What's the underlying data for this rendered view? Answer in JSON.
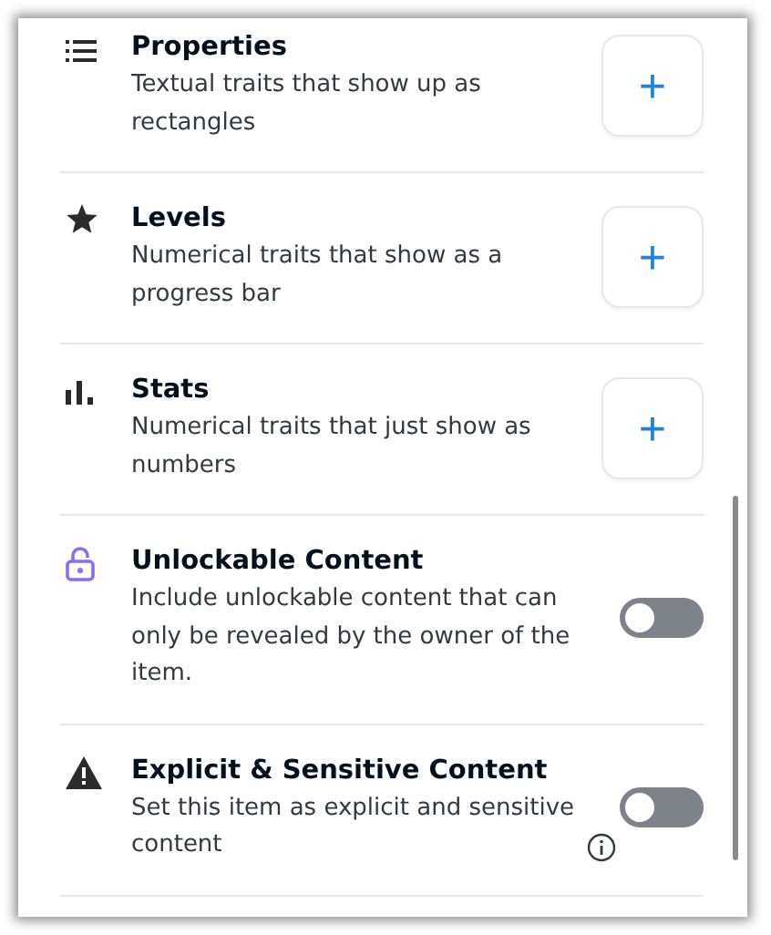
{
  "sections": [
    {
      "kind": "add",
      "title": "Properties",
      "description": "Textual traits that show up as rectangles",
      "button": "+"
    },
    {
      "kind": "add",
      "title": "Levels",
      "description": "Numerical traits that show as a progress bar",
      "button": "+"
    },
    {
      "kind": "add",
      "title": "Stats",
      "description": "Numerical traits that just show as numbers",
      "button": "+"
    },
    {
      "kind": "toggle",
      "title": "Unlockable Content",
      "description": "Include unlockable content that can only be revealed by the owner of the item.",
      "on": false
    },
    {
      "kind": "toggle",
      "title": "Explicit & Sensitive Content",
      "description": "Set this item as explicit and sensitive content",
      "on": false,
      "info_icon": true
    }
  ]
}
